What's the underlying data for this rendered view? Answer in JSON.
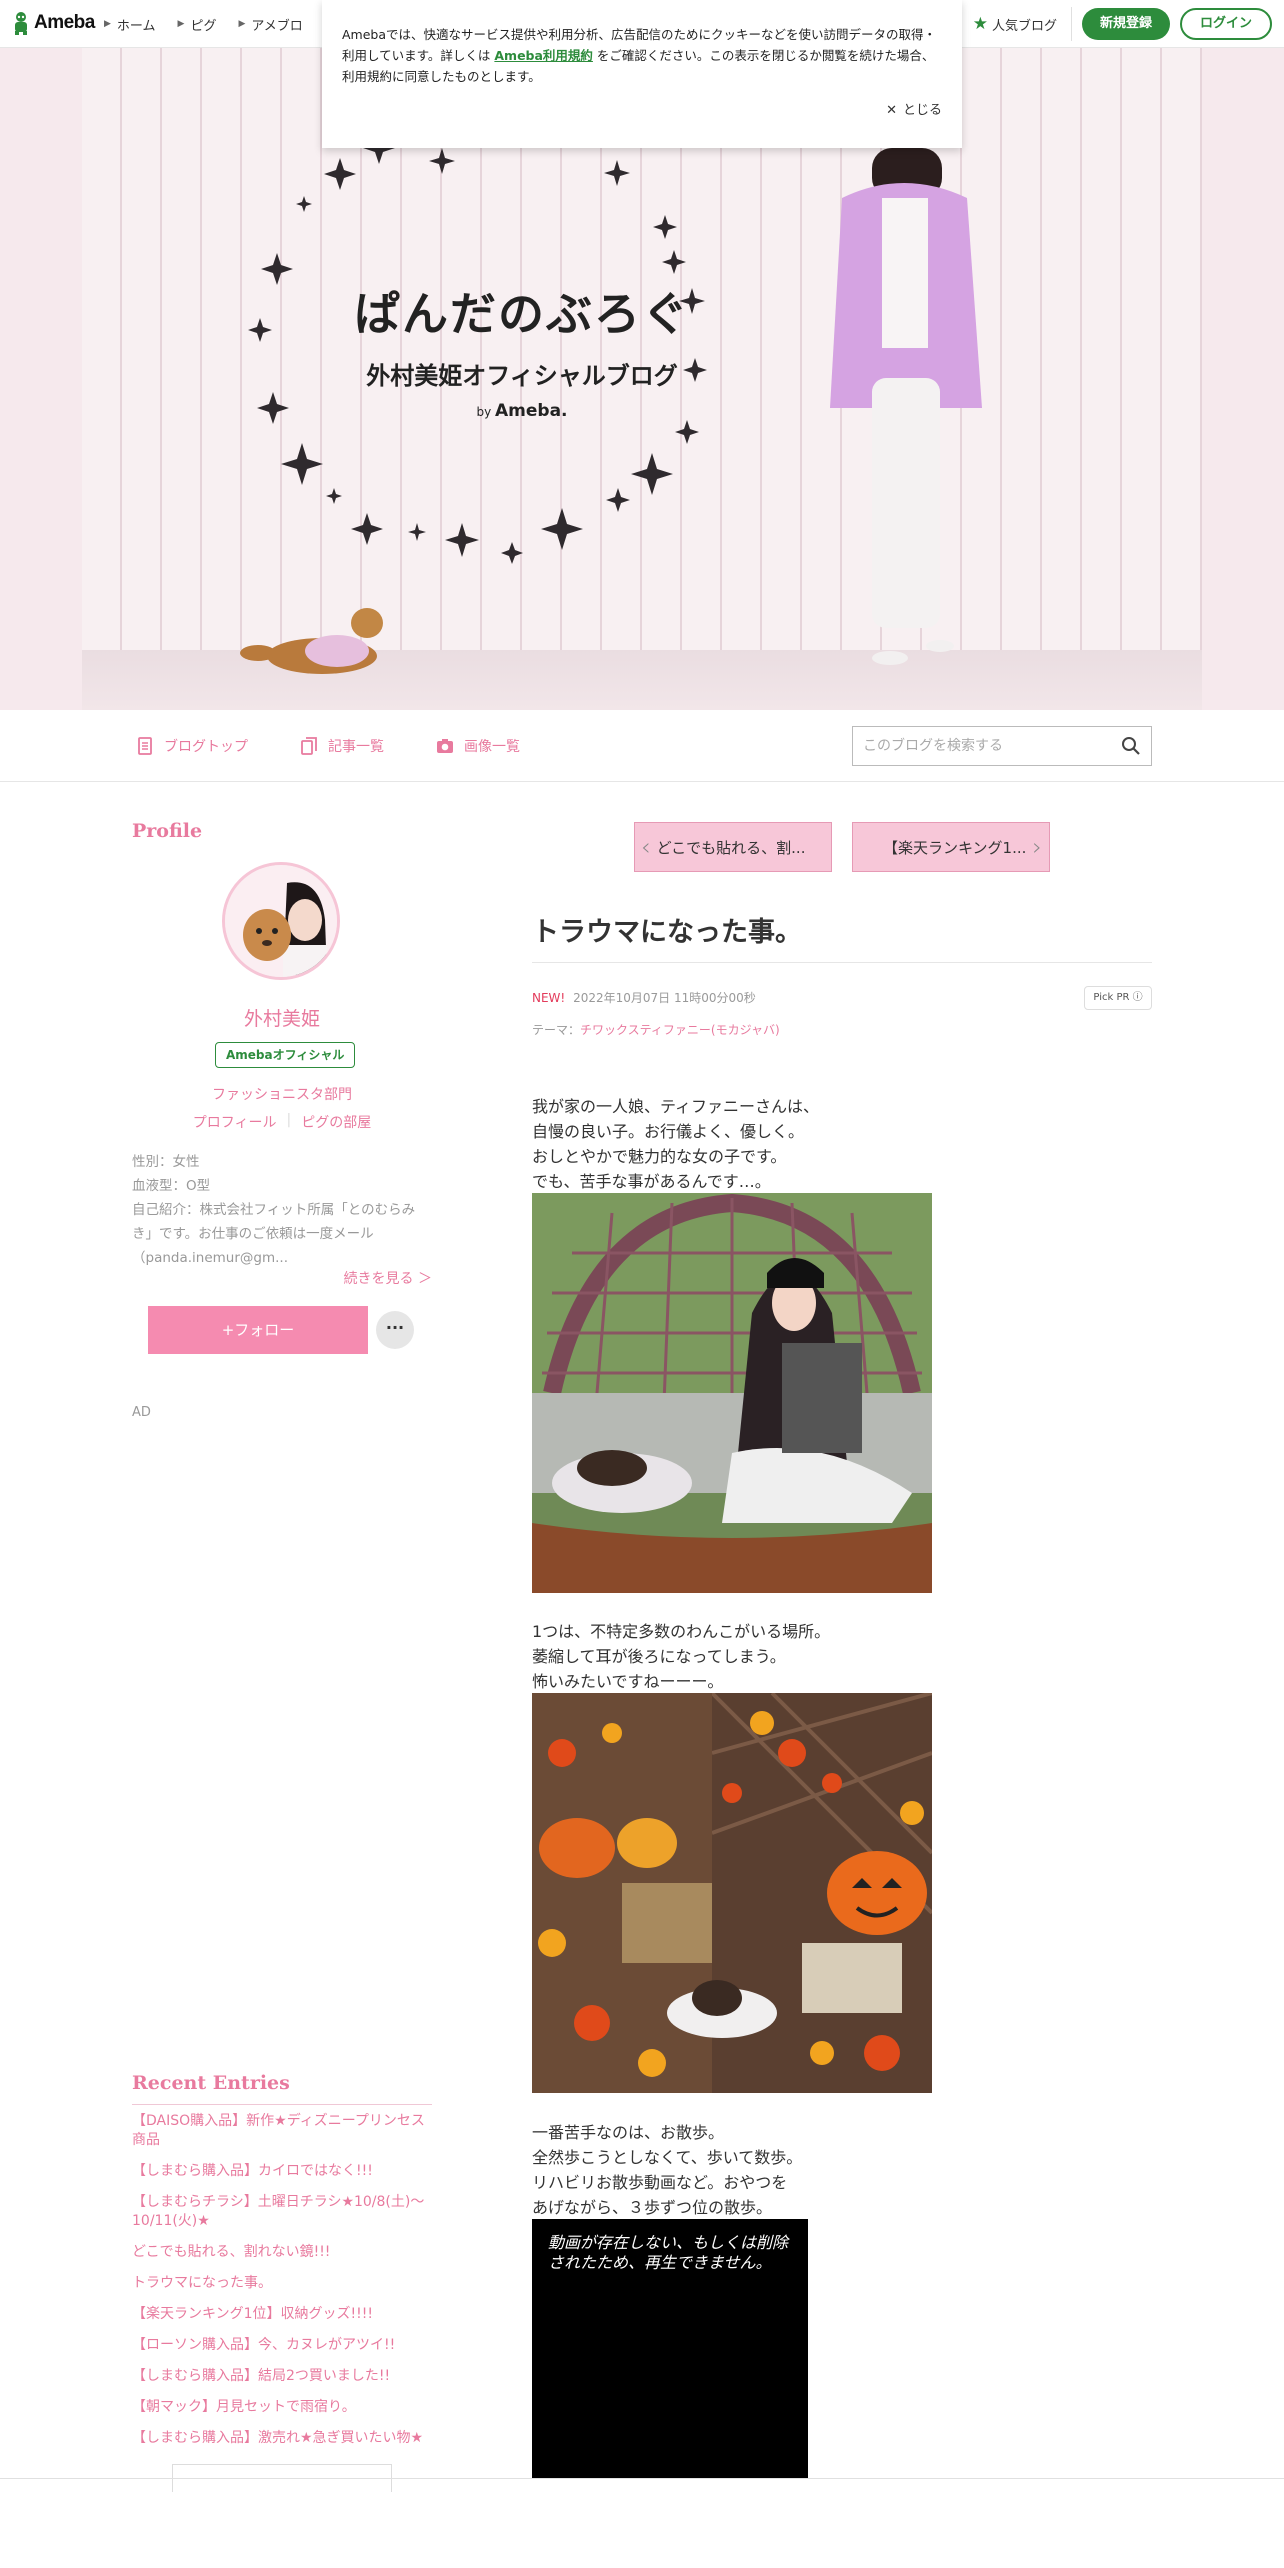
{
  "topbar": {
    "logo_text": "Ameba",
    "nav": [
      "ホーム",
      "ピグ",
      "アメブロ"
    ],
    "popular_label": "人気ブログ",
    "signup_label": "新規登録",
    "login_label": "ログイン",
    "brand_color": "#2d8c3c"
  },
  "cookie_notice": {
    "text_before_link": "Amebaでは、快適なサービス提供や利用分析、広告配信のためにクッキーなどを使い訪問データの取得・利用しています。詳しくは",
    "link_text": "Ameba利用規約",
    "text_after_link": "をご確認ください。この表示を閉じるか閲覧を続けた場合、利用規約に同意したものとします。",
    "close_label": "とじる"
  },
  "banner": {
    "blog_title": "ぱんだのぶろぐ",
    "subtitle": "外村美姫オフィシャルブログ",
    "by_prefix": "by",
    "by_brand": "Ameba."
  },
  "blog_nav": {
    "items": [
      "ブログトップ",
      "記事一覧",
      "画像一覧"
    ],
    "search_placeholder": "このブログを検索する",
    "accent_color": "#e87a9e"
  },
  "sidebar": {
    "profile_heading": "Profile",
    "name": "外村美姫",
    "official_badge": "Amebaオフィシャル",
    "category": "ファッショニスタ部門",
    "links": [
      "プロフィール",
      "ピグの部屋"
    ],
    "info": [
      "性別：女性",
      "血液型：O型",
      "自己紹介：株式会社フィット所属「とのむらみき」です。お仕事のご依頼は一度メール（panda.inemur@gm..."
    ],
    "more_link": "続きを見る ＞",
    "follow_label": "+フォロー",
    "more_button": "···",
    "ad_label": "AD",
    "recent_heading": "Recent Entries",
    "recent_entries": [
      "【DAISO購入品】新作★ディズニープリンセス商品",
      "【しまむら購入品】カイロではなく!!!",
      "【しまむらチラシ】土曜日チラシ★10/8(土)～10/11(火)★",
      "どこでも貼れる、割れない鏡!!!",
      "トラウマになった事。",
      "【楽天ランキング1位】収納グッズ!!!!",
      "【ローソン購入品】今、カヌレがアツイ!!",
      "【しまむら購入品】結局2つ買いました!!",
      "【朝マック】月見セットで雨宿り。",
      "【しまむら購入品】激売れ★急ぎ買いたい物★"
    ]
  },
  "article": {
    "prev_label": "どこでも貼れる、割...",
    "next_label": "【楽天ランキング1...",
    "title": "トラウマになった事。",
    "new_badge": "NEW!",
    "date": "2022年10月07日 11時00分00秒",
    "pickpr": "Pick PR ⓘ",
    "theme_prefix": "テーマ：",
    "theme_link": "チワックスティファニー(モカジャバ)",
    "para1": [
      "我が家の一人娘、ティファニーさんは、",
      "自慢の良い子。お行儀よく、優しく。",
      "おしとやかで魅力的な女の子です。",
      "でも、苦手な事があるんです…。"
    ],
    "para2": [
      "1つは、不特定多数のわんこがいる場所。",
      "萎縮して耳が後ろになってしまう。",
      "怖いみたいですねーーー。"
    ],
    "para3": [
      "一番苦手なのは、お散歩。",
      "全然歩こうとしなくて、歩いて数歩。",
      "リハビリお散歩動画など。おやつを",
      "あげながら、３歩ずつ位の散歩。"
    ],
    "video_error": "動画が存在しない、もしくは削除されたため、再生できません。"
  }
}
